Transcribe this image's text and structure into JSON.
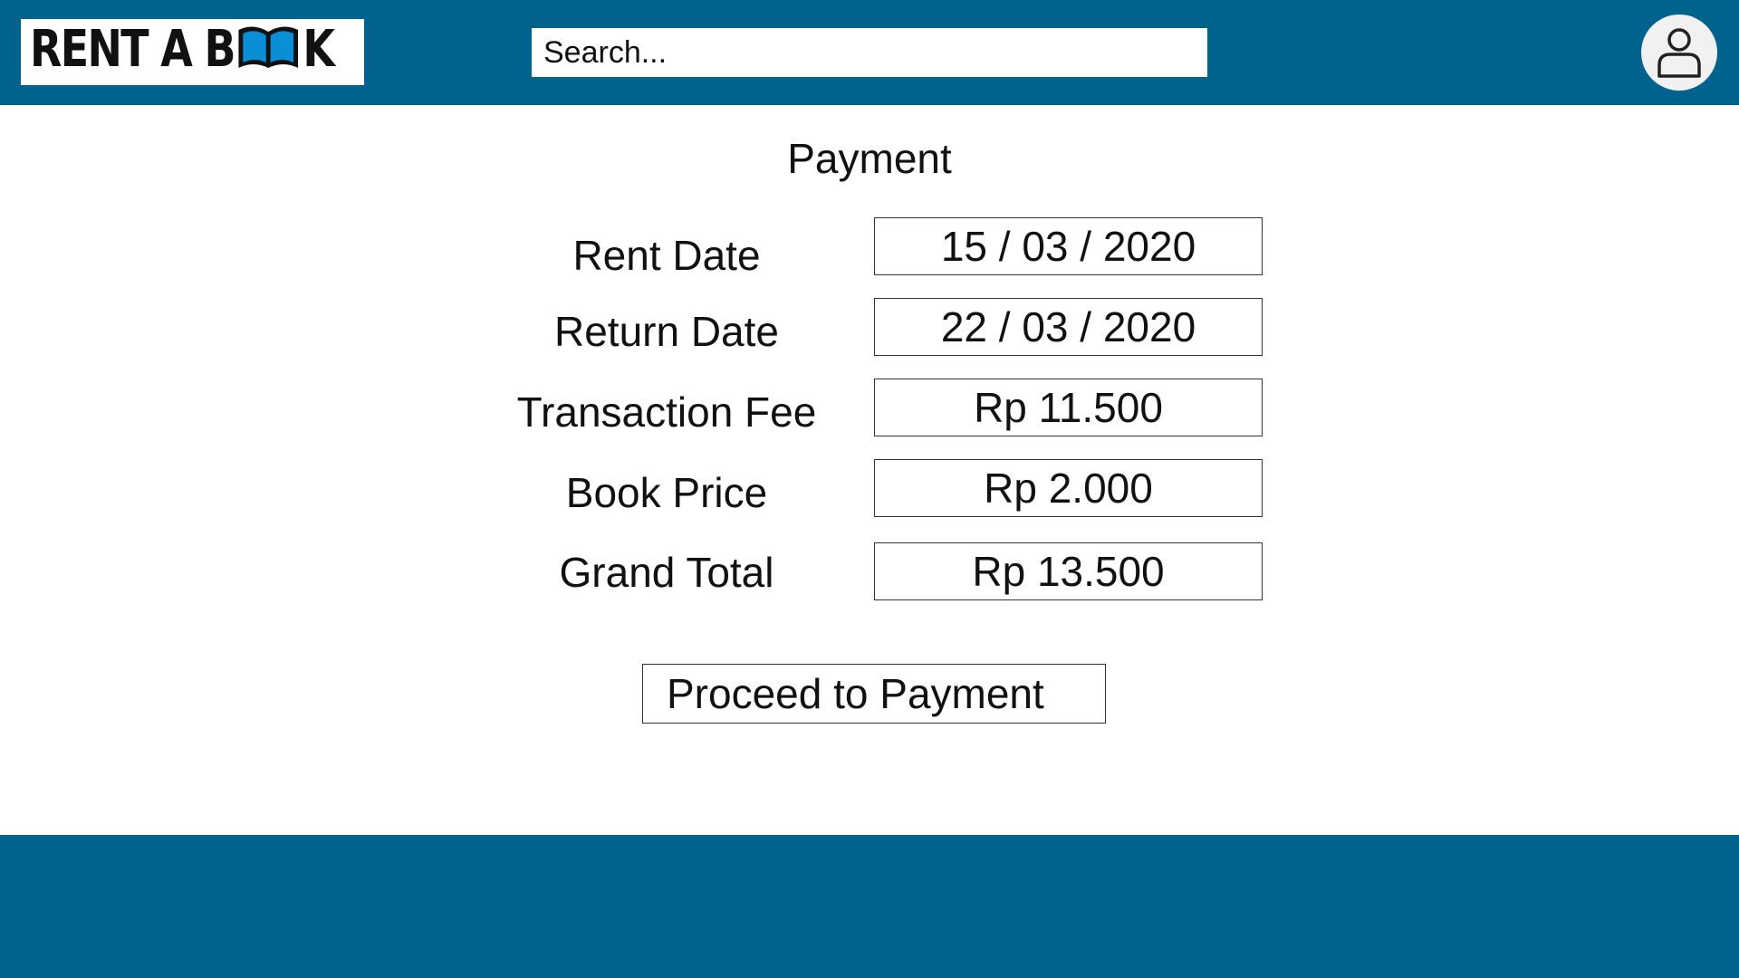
{
  "brand": {
    "logo_text_before": "RENT A B",
    "logo_text_after": "K",
    "logo_icon": "open-book-icon"
  },
  "search": {
    "placeholder": "Search..."
  },
  "user": {
    "icon": "user-icon"
  },
  "page": {
    "title": "Payment"
  },
  "details": [
    {
      "label": "Rent Date",
      "value": "15 / 03 / 2020"
    },
    {
      "label": "Return Date",
      "value": "22 / 03 / 2020"
    },
    {
      "label": "Transaction Fee",
      "value": "Rp 11.500"
    },
    {
      "label": "Book Price",
      "value": "Rp 2.000"
    },
    {
      "label": "Grand Total",
      "value": "Rp 13.500"
    }
  ],
  "actions": {
    "proceed_label": "Proceed to Payment"
  },
  "colors": {
    "brand_blue": "#00638e",
    "book_blue": "#0a8fd6"
  }
}
